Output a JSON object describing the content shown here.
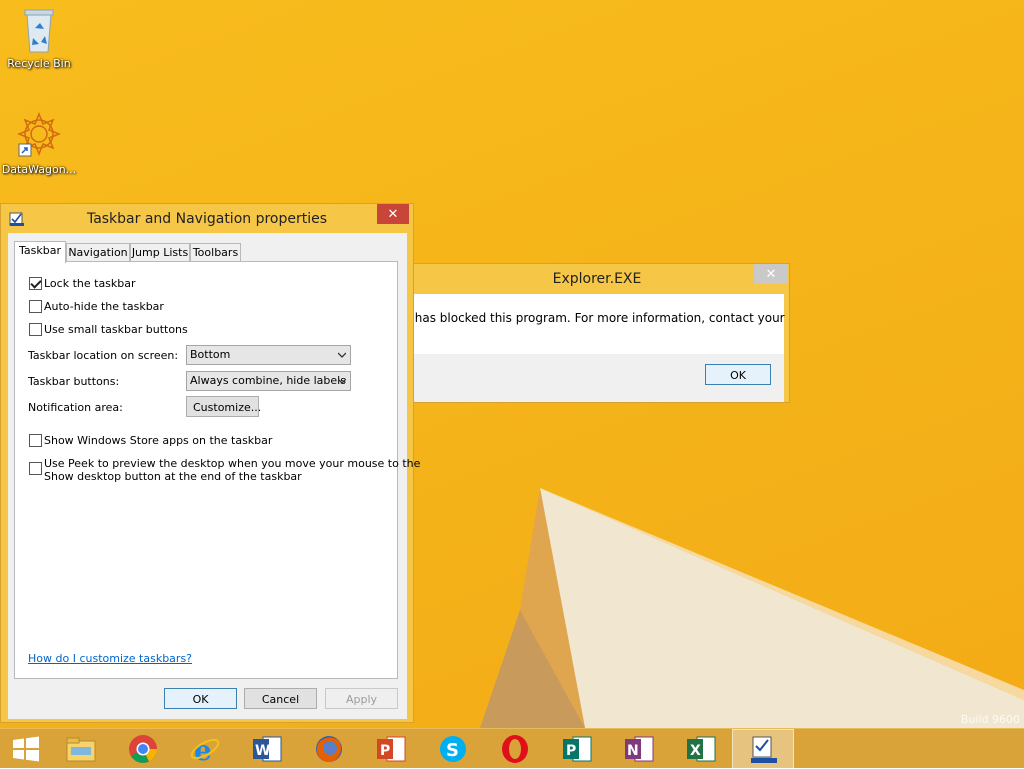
{
  "desktop": {
    "icons": [
      {
        "label": "Recycle Bin"
      },
      {
        "label": "DataWagon..."
      }
    ],
    "watermark": "Build 9600"
  },
  "explorer_dialog": {
    "title": "Explorer.EXE",
    "close_label": "✕",
    "message": "r has blocked this program. For more information, contact your",
    "ok_label": "OK"
  },
  "properties_dialog": {
    "title": "Taskbar and Navigation properties",
    "close_label": "✕",
    "tabs": [
      {
        "label": "Taskbar",
        "active": true
      },
      {
        "label": "Navigation",
        "active": false
      },
      {
        "label": "Jump Lists",
        "active": false
      },
      {
        "label": "Toolbars",
        "active": false
      }
    ],
    "lock_taskbar": {
      "label": "Lock the taskbar",
      "checked": true
    },
    "auto_hide": {
      "label": "Auto-hide the taskbar",
      "checked": false
    },
    "small_buttons": {
      "label": "Use small taskbar buttons",
      "checked": false
    },
    "location": {
      "label": "Taskbar location on screen:",
      "value": "Bottom"
    },
    "buttons": {
      "label": "Taskbar buttons:",
      "value": "Always combine, hide labels"
    },
    "notification": {
      "label": "Notification area:",
      "button_label": "Customize..."
    },
    "store_apps": {
      "label": "Show Windows Store apps on the taskbar",
      "checked": false
    },
    "peek": {
      "label_line1": "Use Peek to preview the desktop when you move your mouse to the",
      "label_line2": "Show desktop button at the end of the taskbar",
      "checked": false
    },
    "help_link": "How do I customize taskbars?",
    "ok_label": "OK",
    "cancel_label": "Cancel",
    "apply_label": "Apply"
  },
  "taskbar": {
    "items": [
      {
        "icon": "windows-start-icon"
      },
      {
        "icon": "file-explorer-icon"
      },
      {
        "icon": "chrome-icon"
      },
      {
        "icon": "internet-explorer-icon"
      },
      {
        "icon": "word-icon"
      },
      {
        "icon": "firefox-icon"
      },
      {
        "icon": "powerpoint-icon"
      },
      {
        "icon": "skype-icon"
      },
      {
        "icon": "opera-icon"
      },
      {
        "icon": "publisher-icon"
      },
      {
        "icon": "onenote-icon"
      },
      {
        "icon": "excel-icon"
      },
      {
        "icon": "taskbar-properties-icon"
      }
    ]
  },
  "colors": {
    "desktop_bg": "#f5b51a",
    "dialog_frame": "#f6c646",
    "close_red": "#c74639",
    "taskbar": "#d9a33a",
    "link_blue": "#0066cc"
  }
}
